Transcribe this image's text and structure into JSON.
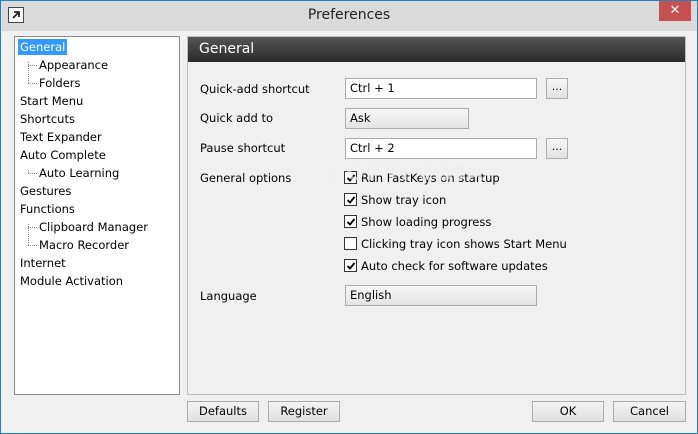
{
  "window": {
    "title": "Preferences",
    "close_symbol": "✕"
  },
  "sidebar": {
    "items": [
      {
        "label": "General",
        "level": 0,
        "selected": true
      },
      {
        "label": "Appearance",
        "level": 1
      },
      {
        "label": "Folders",
        "level": 1
      },
      {
        "label": "Start Menu",
        "level": 0
      },
      {
        "label": "Shortcuts",
        "level": 0
      },
      {
        "label": "Text Expander",
        "level": 0
      },
      {
        "label": "Auto Complete",
        "level": 0
      },
      {
        "label": "Auto Learning",
        "level": 1
      },
      {
        "label": "Gestures",
        "level": 0
      },
      {
        "label": "Functions",
        "level": 0
      },
      {
        "label": "Clipboard Manager",
        "level": 1
      },
      {
        "label": "Macro Recorder",
        "level": 1
      },
      {
        "label": "Internet",
        "level": 0
      },
      {
        "label": "Module Activation",
        "level": 0
      }
    ]
  },
  "panel": {
    "header": "General",
    "quick_add_shortcut": {
      "label": "Quick-add shortcut",
      "value": "Ctrl + 1",
      "browse": "..."
    },
    "quick_add_to": {
      "label": "Quick add to",
      "value": "Ask"
    },
    "pause_shortcut": {
      "label": "Pause shortcut",
      "value": "Ctrl + 2",
      "browse": "..."
    },
    "general_options": {
      "label": "General options",
      "options": [
        {
          "label": "Run FastKeys on startup",
          "checked": true
        },
        {
          "label": "Show tray icon",
          "checked": true
        },
        {
          "label": "Show loading progress",
          "checked": true
        },
        {
          "label": "Clicking tray icon shows Start Menu",
          "checked": false
        },
        {
          "label": "Auto check for software updates",
          "checked": true
        }
      ]
    },
    "language": {
      "label": "Language",
      "value": "English"
    }
  },
  "footer": {
    "defaults": "Defaults",
    "register": "Register",
    "ok": "OK",
    "cancel": "Cancel"
  },
  "watermark": "SOFTPEDIA",
  "colors": {
    "selection": "#3399ff",
    "close_button": "#c75050",
    "header_bg": "#333333",
    "window_border": "#2a7fb8"
  }
}
